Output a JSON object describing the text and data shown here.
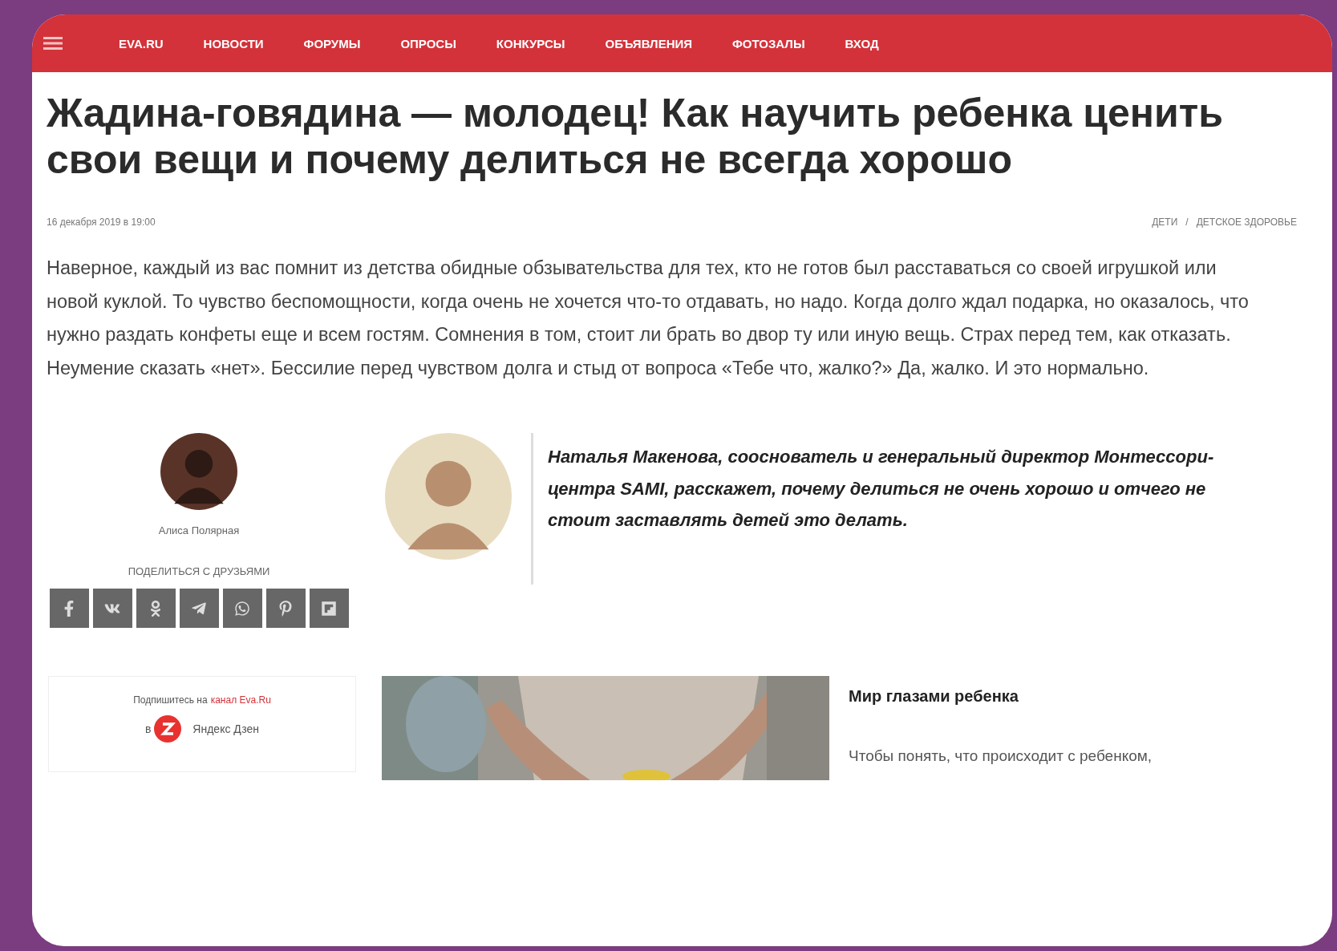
{
  "nav": {
    "items": [
      {
        "label": "EVA.RU"
      },
      {
        "label": "НОВОСТИ"
      },
      {
        "label": "ФОРУМЫ"
      },
      {
        "label": "ОПРОСЫ"
      },
      {
        "label": "КОНКУРСЫ"
      },
      {
        "label": "ОБЪЯВЛЕНИЯ"
      },
      {
        "label": "ФОТОЗАЛЫ"
      },
      {
        "label": "ВХОД"
      }
    ]
  },
  "article": {
    "title": "Жадина-говядина — молодец! Как научить ребенка ценить свои вещи и почему делиться не всегда хорошо",
    "date": "16 декабря 2019 в 19:00",
    "categories": [
      {
        "label": "ДЕТИ"
      },
      {
        "label": "ДЕТСКОЕ ЗДОРОВЬЕ"
      }
    ],
    "category_separator": "/",
    "lead": "Наверное, каждый из вас помнит из детства обидные обзывательства для тех, кто не готов был расставаться со своей игрушкой или новой куклой. То чувство беспомощности, когда очень не хочется что-то отдавать, но надо. Когда долго ждал подарка, но оказалось, что нужно раздать конфеты еще и всем гостям. Сомнения в том, стоит ли брать во двор ту или иную вещь. Страх перед тем, как отказать. Неумение сказать «нет». Бессилие перед чувством долга и стыд от вопроса «Тебе что, жалко?» Да, жалко. И это нормально.",
    "author": {
      "name": "Алиса Полярная"
    },
    "share_label": "ПОДЕЛИТЬСЯ С ДРУЗЬЯМИ",
    "expert_quote": "Наталья Макенова, сооснователь и генеральный директор Монтессори-центра SAMI, расскажет, почему делиться не очень хорошо и отчего не стоит заставлять детей это делать.",
    "subscribe": {
      "text": "Подпишитесь на",
      "link": "канал Eva.Ru",
      "prefix": "в",
      "service": "Яндекс Дзен"
    },
    "related": {
      "title": "Мир глазами ребенка",
      "text": "Чтобы понять, что происходит с ребенком,"
    }
  }
}
